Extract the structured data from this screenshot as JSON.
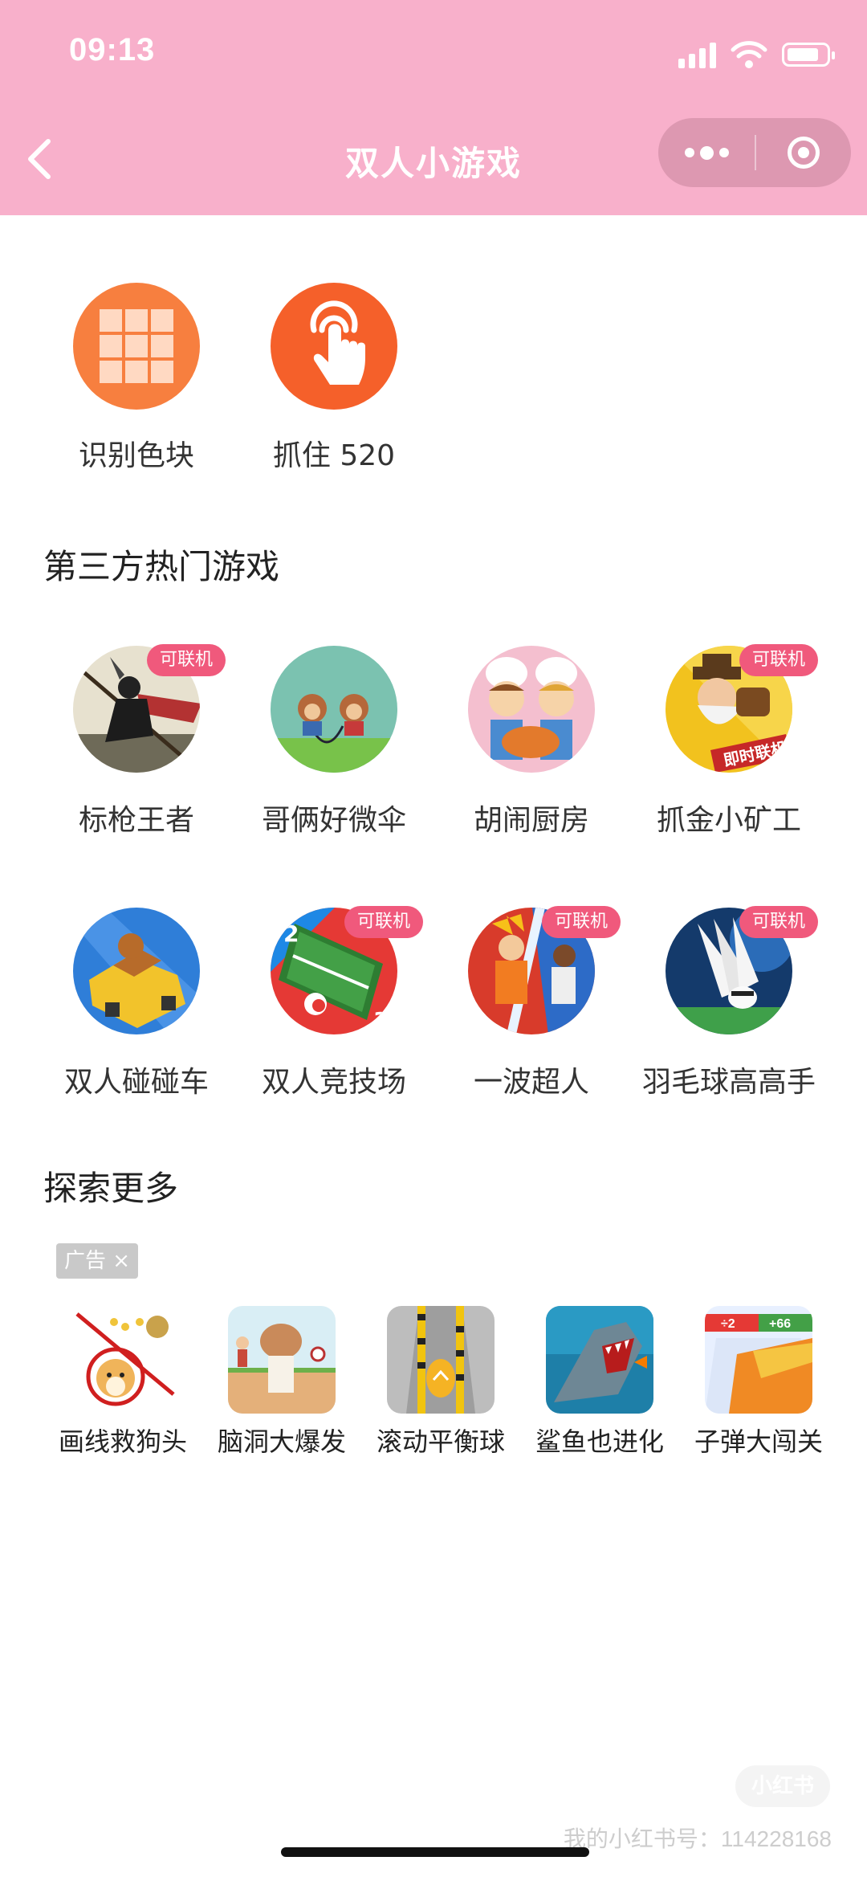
{
  "status_bar": {
    "time": "09:13"
  },
  "nav": {
    "title": "双人小游戏"
  },
  "top_items": [
    {
      "label": "识别色块",
      "icon": "grid-icon",
      "color": "#f77f3f"
    },
    {
      "label": "抓住 520",
      "icon": "tap-hand-icon",
      "color": "#f5602a"
    }
  ],
  "sections": {
    "hot": {
      "title": "第三方热门游戏"
    },
    "explore": {
      "title": "探索更多"
    }
  },
  "badge_label": "可联机",
  "hot_games": [
    {
      "label": "标枪王者",
      "online": true
    },
    {
      "label": "哥俩好微伞",
      "online": false
    },
    {
      "label": "胡闹厨房",
      "online": false
    },
    {
      "label": "抓金小矿工",
      "online": true
    },
    {
      "label": "双人碰碰车",
      "online": false
    },
    {
      "label": "双人竞技场",
      "online": true
    },
    {
      "label": "一波超人",
      "online": true
    },
    {
      "label": "羽毛球高高手",
      "online": true
    }
  ],
  "ad": {
    "tag": "广告"
  },
  "more_games": [
    {
      "label": "画线救狗头"
    },
    {
      "label": "脑洞大爆发"
    },
    {
      "label": "滚动平衡球"
    },
    {
      "label": "鲨鱼也进化"
    },
    {
      "label": "子弹大闯关"
    }
  ],
  "miner_art_text": "即时联机",
  "watermark": {
    "badge": "小红书",
    "text": "我的小红书号：114228168"
  }
}
